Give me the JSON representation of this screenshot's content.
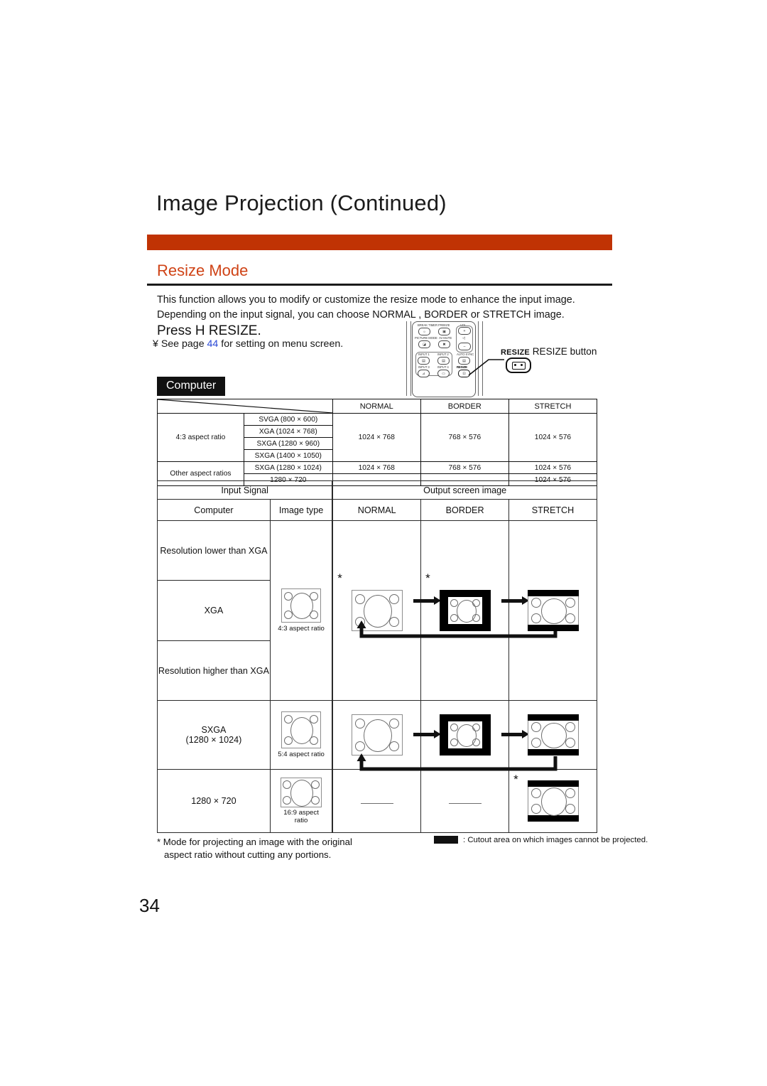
{
  "page": {
    "title": "Image Projection (Continued)",
    "section_title": "Resize Mode",
    "page_number": "34",
    "accent_bar_color": "#c03304",
    "section_title_color": "#cf4316",
    "link_color": "#2a49d6"
  },
  "intro": {
    "paragraph": "This function allows you to modify or customize the resize mode to enhance the input image. Depending on the input signal, you can choose  NORMAL ,  BORDER  or  STRETCH  image.",
    "press_instruction": "Press H  RESIZE.",
    "see_page_prefix": "¥ See page ",
    "see_page_number": "44",
    "see_page_suffix": " for setting on menu screen."
  },
  "remote": {
    "callout_small": "RESIZE",
    "callout_text": " RESIZE button",
    "labels": {
      "break_timer": "BREAK TIMER",
      "freeze": "FREEZE",
      "vol": "VOL",
      "picture_mode": "PICTURE MODE",
      "av_mute": "AV MUTE",
      "input1": "INPUT 1",
      "input2": "INPUT 2",
      "auto_sync": "AUTO SYNC",
      "input3": "INPUT 3",
      "input4": "INPUT 4",
      "resize": "RESIZE",
      "vol_plus": "+",
      "vol_minus": "–"
    }
  },
  "badge": {
    "label": "Computer"
  },
  "table1": {
    "headers": [
      "",
      "",
      "NORMAL",
      "BORDER",
      "STRETCH"
    ],
    "rows": [
      {
        "group": "4:3 aspect ratio",
        "signals": [
          "SVGA (800 × 600)",
          "XGA (1024 × 768)",
          "SXGA (1280 × 960)",
          "SXGA  (1400 × 1050)"
        ],
        "normal": "1024 × 768",
        "border": "768 × 576",
        "stretch": "1024 × 576"
      },
      {
        "group": "Other aspect ratios",
        "signals": [
          "SXGA (1280 × 1024)",
          "1280 × 720"
        ],
        "normal": [
          "1024 × 768",
          ""
        ],
        "border": [
          "768 × 576",
          ""
        ],
        "stretch": [
          "1024 × 576",
          "1024 × 576"
        ]
      }
    ]
  },
  "table2": {
    "header_input_signal": "Input Signal",
    "header_output_screen": "Output screen image",
    "col_computer": "Computer",
    "col_image_type": "Image type",
    "col_normal": "NORMAL",
    "col_border": "BORDER",
    "col_stretch": "STRETCH",
    "rows": [
      {
        "computer": "Resolution lower than XGA",
        "image_type": ""
      },
      {
        "computer": "XGA",
        "image_type": "4:3 aspect ratio"
      },
      {
        "computer": "Resolution higher than XGA",
        "image_type": ""
      },
      {
        "computer": "SXGA\n(1280 × 1024)",
        "image_type": "5:4 aspect ratio"
      },
      {
        "computer": "1280 × 720",
        "image_type": "16:9 aspect\nratio"
      }
    ],
    "sxga_line1": "SXGA",
    "sxga_line2": "(1280 × 1024)",
    "last_row_label": "1280 × 720",
    "caption_43": "4:3 aspect ratio",
    "caption_54": "5:4 aspect ratio",
    "caption_169_l1": "16:9 aspect",
    "caption_169_l2": "ratio"
  },
  "footnotes": {
    "asterisk_note_l1": "* Mode for projecting an image with the original",
    "asterisk_note_l2": "aspect ratio without cutting any portions.",
    "cutout_note": ": Cutout area on which images cannot be projected."
  }
}
